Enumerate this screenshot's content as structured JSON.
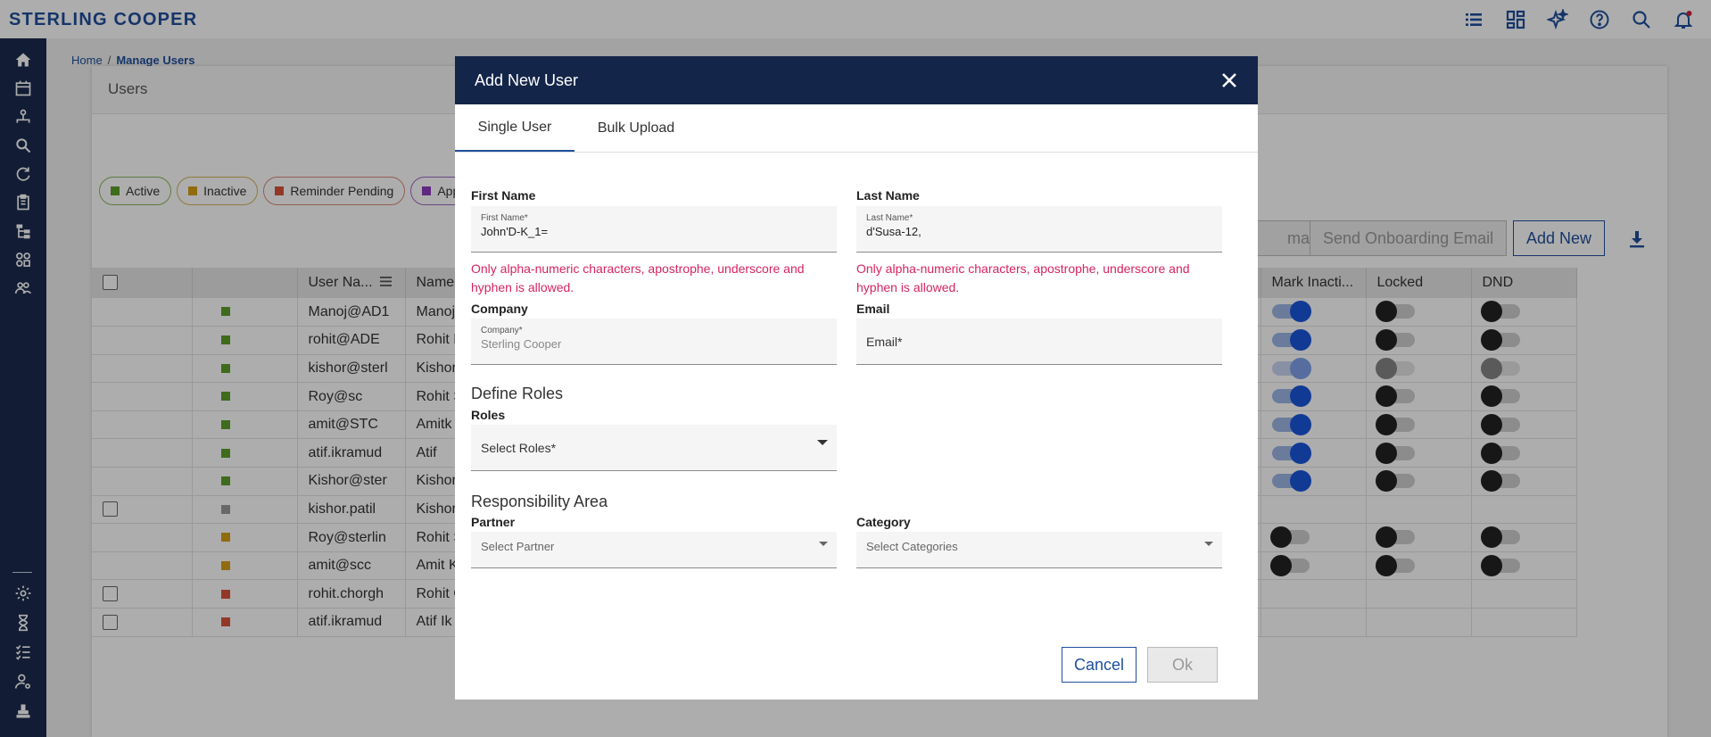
{
  "app": {
    "logo": "STERLING COOPER",
    "top_icons": [
      "list-icon",
      "dashboard-icon",
      "sparkle-icon",
      "help-icon",
      "search-icon",
      "bell-icon"
    ]
  },
  "sidenav": {
    "items": [
      "home-icon",
      "calendar-icon",
      "org-chart-icon",
      "search-people-icon",
      "refresh-icon",
      "clipboard-icon",
      "hierarchy-icon",
      "apps-icon",
      "group-settings-icon"
    ],
    "bottom_items": [
      "gear-icon",
      "hourglass-icon",
      "checklist-icon",
      "user-settings-icon",
      "stamp-icon"
    ]
  },
  "breadcrumb": {
    "home": "Home",
    "separator": "/",
    "current": "Manage Users"
  },
  "panel": {
    "title": "Users",
    "chips": [
      {
        "label": "Active",
        "color": "#5aa02c",
        "border": "#8bb55a"
      },
      {
        "label": "Inactive",
        "color": "#d4a017",
        "border": "#d4b35a"
      },
      {
        "label": "Reminder Pending",
        "color": "#d9533b",
        "border": "#d98a7a"
      },
      {
        "label": "App",
        "color": "#8e3bbf",
        "border": "#9a6ac4"
      }
    ],
    "buttons": {
      "email_partial": "mail",
      "send_onboarding": "Send Onboarding Email",
      "add_new": "Add New"
    },
    "columns": [
      "User Na...",
      "Name",
      "Mark Inacti...",
      "Locked",
      "DND"
    ],
    "rows": [
      {
        "user": "Manoj@AD1",
        "name": "Manoj",
        "status": "#5aa02c",
        "cb": false,
        "mark": "on",
        "locked": "off",
        "dnd": "off"
      },
      {
        "user": "rohit@ADE",
        "name": "Rohit K",
        "status": "#5aa02c",
        "cb": false,
        "mark": "on",
        "locked": "off",
        "dnd": "off"
      },
      {
        "user": "kishor@sterl",
        "name": "Kishor",
        "status": "#5aa02c",
        "cb": false,
        "mark": "on-dim",
        "locked": "dim",
        "dnd": "dim"
      },
      {
        "user": "Roy@sc",
        "name": "Rohit S",
        "status": "#5aa02c",
        "cb": false,
        "mark": "on",
        "locked": "off",
        "dnd": "off"
      },
      {
        "user": "amit@STC",
        "name": "Amitk",
        "status": "#5aa02c",
        "cb": false,
        "mark": "on",
        "locked": "off",
        "dnd": "off"
      },
      {
        "user": "atif.ikramud",
        "name": "Atif",
        "status": "#5aa02c",
        "cb": false,
        "mark": "on",
        "locked": "off",
        "dnd": "off"
      },
      {
        "user": "Kishor@ster",
        "name": "Kishor",
        "status": "#5aa02c",
        "cb": false,
        "mark": "on",
        "locked": "off",
        "dnd": "off"
      },
      {
        "user": "kishor.patil",
        "name": "Kishor",
        "status": "#9a9a9a",
        "cb": true,
        "mark": "none",
        "locked": "none",
        "dnd": "none"
      },
      {
        "user": "Roy@sterlin",
        "name": "Rohit S",
        "status": "#d4a017",
        "cb": false,
        "mark": "off",
        "locked": "off",
        "dnd": "off"
      },
      {
        "user": "amit@scc",
        "name": "Amit K",
        "status": "#d4a017",
        "cb": false,
        "mark": "off",
        "locked": "off",
        "dnd": "off"
      },
      {
        "user": "rohit.chorgh",
        "name": "Rohit C",
        "status": "#d9533b",
        "cb": true,
        "mark": "none",
        "locked": "none",
        "dnd": "none"
      },
      {
        "user": "atif.ikramud",
        "name": "Atif Ik",
        "status": "#d9533b",
        "cb": true,
        "mark": "none",
        "locked": "none",
        "dnd": "none"
      }
    ]
  },
  "modal": {
    "title": "Add New User",
    "tabs": [
      "Single User",
      "Bulk Upload"
    ],
    "first_name": {
      "label": "First Name",
      "float_label": "First Name*",
      "value": "John'D-K_1="
    },
    "last_name": {
      "label": "Last Name",
      "float_label": "Last Name*",
      "value": "d'Susa-12,"
    },
    "error_text": "Only alpha-numeric characters, apostrophe, underscore and hyphen is allowed.",
    "company": {
      "label": "Company",
      "float_label": "Company*",
      "value": "Sterling Cooper"
    },
    "email": {
      "label": "Email",
      "placeholder": "Email*"
    },
    "define_roles": "Define Roles",
    "roles": {
      "label": "Roles",
      "placeholder": "Select Roles*"
    },
    "responsibility_area": "Responsibility Area",
    "partner": {
      "label": "Partner",
      "placeholder": "Select Partner"
    },
    "category": {
      "label": "Category",
      "placeholder": "Select Categories"
    },
    "cancel": "Cancel",
    "ok": "Ok"
  }
}
